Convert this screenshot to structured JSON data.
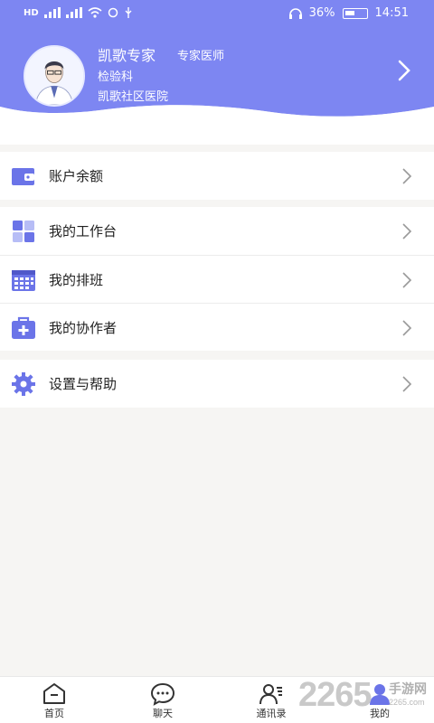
{
  "colors": {
    "brand": "#7d86f2",
    "icon": "#6b74e8"
  },
  "status_bar": {
    "net_left": "HD",
    "battery_pct": "36%",
    "time": "14:51"
  },
  "profile": {
    "name": "凯歌专家",
    "title": "专家医师",
    "department": "检验科",
    "hospital": "凯歌社区医院"
  },
  "menu": {
    "balance": "账户余额",
    "workbench": "我的工作台",
    "schedule": "我的排班",
    "collaborators": "我的协作者",
    "settings": "设置与帮助"
  },
  "tabs": [
    {
      "label": "首页",
      "icon": "home-icon"
    },
    {
      "label": "聊天",
      "icon": "chat-icon"
    },
    {
      "label": "通讯录",
      "icon": "contacts-icon"
    },
    {
      "label": "我的",
      "icon": "profile-icon"
    }
  ],
  "watermark": {
    "number": "2265",
    "text": "手游网",
    "url": "2265.com"
  }
}
